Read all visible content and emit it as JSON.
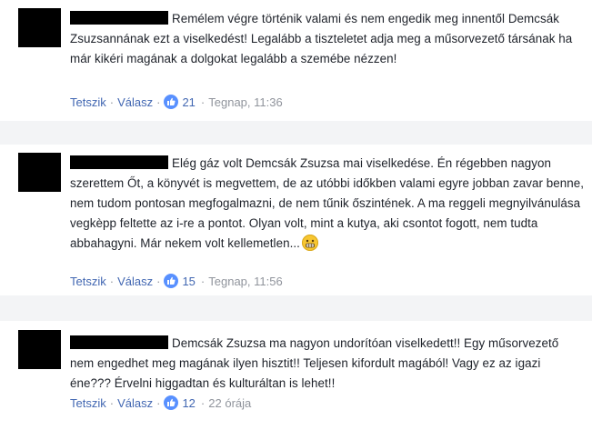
{
  "comments": [
    {
      "text": "Remélem végre történik valami és nem engedik meg innentől Demcsák Zsuzsannának ezt a viselkedést! Legalább a tiszteletet adja meg a műsorvezető társának ha már kikéri magának a dolgokat legalább a szemébe nézzen!",
      "like_label": "Tetszik",
      "reply_label": "Válasz",
      "like_count": "21",
      "timestamp": "Tegnap, 11:36"
    },
    {
      "text": "Elég gáz volt Demcsák Zsuzsa mai viselkedése. Én régebben nagyon szerettem Őt, a könyvét is megvettem, de az utóbbi időkben valami egyre jobban zavar benne, nem tudom pontosan megfogalmazni, de nem tűnik őszintének. A ma reggeli megnyilvánulása vegkèpp feltette az i-re a pontot. Olyan volt, mint a kutya, aki csontot fogott, nem tudta abbahagyni. Már nekem volt kellemetlen...",
      "like_label": "Tetszik",
      "reply_label": "Válasz",
      "like_count": "15",
      "timestamp": "Tegnap, 11:56"
    },
    {
      "text": "Demcsák Zsuzsa ma nagyon undorítóan viselkedett!! Egy műsorvezető nem engedhet meg magának ilyen hisztit!! Teljesen kifordult magából! Vagy ez az igazi éne??? Érvelni higgadtan és kulturáltan is lehet!!",
      "like_label": "Tetszik",
      "reply_label": "Válasz",
      "like_count": "12",
      "timestamp": "22 órája"
    }
  ],
  "icons": {
    "like": "thumbs-up-icon",
    "emoji": "grimacing-face-icon"
  },
  "colors": {
    "link": "#4267b2",
    "meta": "#90949c",
    "like_badge": "#5890ff",
    "separator": "#f3f4f6"
  }
}
